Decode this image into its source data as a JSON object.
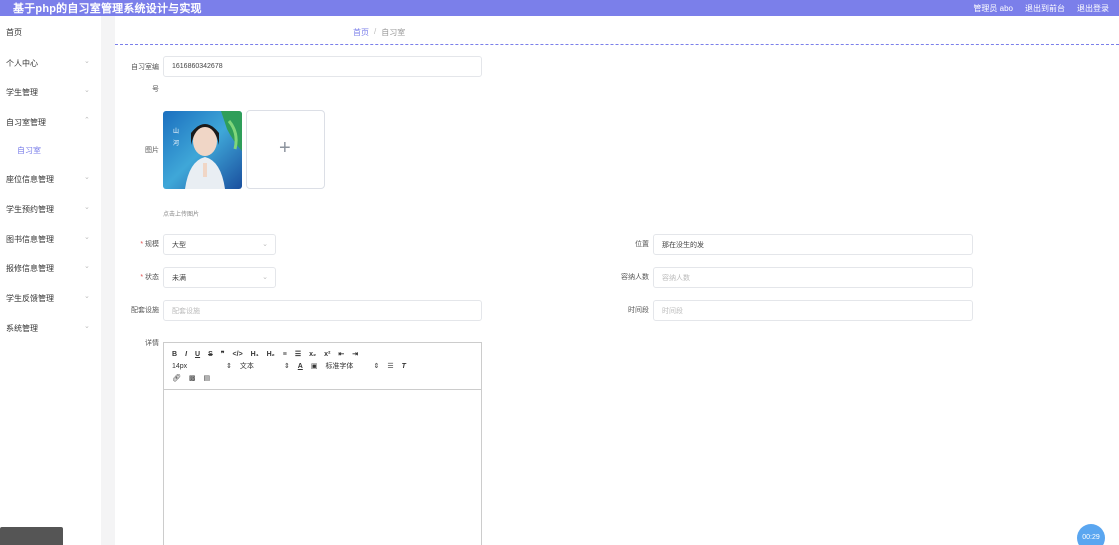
{
  "header": {
    "title": "基于php的自习室管理系统设计与实现",
    "admin": "管理员 abo",
    "to_frontend": "退出到前台",
    "logout": "退出登录"
  },
  "sidebar": {
    "items": [
      {
        "label": "首页"
      },
      {
        "label": "个人中心"
      },
      {
        "label": "学生管理"
      },
      {
        "label": "自习室管理"
      },
      {
        "label": "自习室"
      },
      {
        "label": "座位信息管理"
      },
      {
        "label": "学生预约管理"
      },
      {
        "label": "图书信息管理"
      },
      {
        "label": "报修信息管理"
      },
      {
        "label": "学生反馈管理"
      },
      {
        "label": "系统管理"
      }
    ]
  },
  "breadcrumb": {
    "home": "首页",
    "sep": "/",
    "current": "自习室"
  },
  "form": {
    "room_no_label_1": "自习室编",
    "room_no_label_2": "号",
    "room_no_value": "1616860342678",
    "image_label": "图片",
    "upload_hint": "点击上传图片",
    "size_label": "规模",
    "size_value": "大型",
    "location_label": "位置",
    "location_value": "那在没生的发",
    "status_label": "状态",
    "status_value": "未满",
    "capacity_label": "容纳人数",
    "capacity_placeholder": "容纳人数",
    "facilities_label": "配套设施",
    "facilities_placeholder": "配套设施",
    "timeslot_label": "时间段",
    "timeslot_placeholder": "时间段",
    "details_label": "详情"
  },
  "editor": {
    "row1": [
      "B",
      "I",
      "U",
      "S",
      "❞",
      "</>",
      "H₁",
      "H₂",
      "≡",
      "☰",
      "x₂",
      "x²",
      "⇤",
      "⇥"
    ],
    "font_size": "14px",
    "text_type": "文本",
    "font_family": "标准字体"
  },
  "timer": "00:29"
}
